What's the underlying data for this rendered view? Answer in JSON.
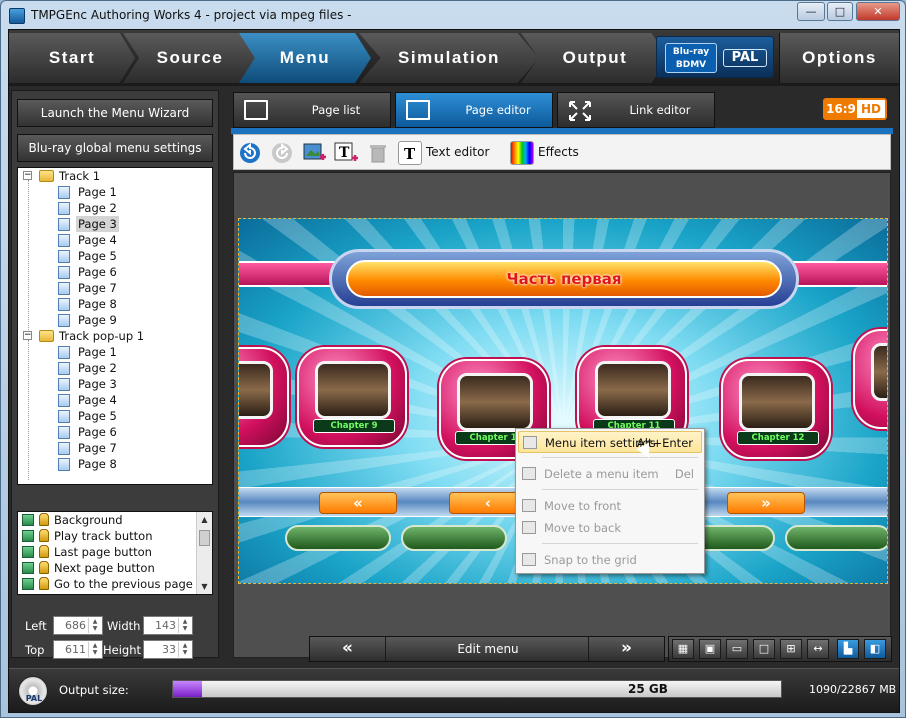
{
  "window": {
    "title": "TMPGEnc Authoring Works 4 - project via mpeg files -",
    "controls": {
      "minimize": "—",
      "maximize": "□",
      "close": "✕"
    }
  },
  "nav": {
    "items": [
      {
        "label": "Start",
        "active": false
      },
      {
        "label": "Source",
        "active": false
      },
      {
        "label": "Menu",
        "active": true
      },
      {
        "label": "Simulation",
        "active": false
      },
      {
        "label": "Output",
        "active": false
      }
    ],
    "format_logo_line1": "Blu-ray",
    "format_logo_line2": "BDMV",
    "format_standard": "PAL",
    "options": "Options"
  },
  "left": {
    "wizard_button": "Launch the Menu Wizard",
    "global_button": "Blu-ray global menu settings",
    "tree": [
      {
        "label": "Track 1",
        "type": "track",
        "expander": "−",
        "pages": [
          "Page 1",
          "Page 2",
          "Page 3",
          "Page 4",
          "Page 5",
          "Page 6",
          "Page 7",
          "Page 8",
          "Page 9"
        ],
        "selected": "Page 3"
      },
      {
        "label": "Track pop-up 1",
        "type": "track",
        "expander": "−",
        "pages": [
          "Page 1",
          "Page 2",
          "Page 3",
          "Page 4",
          "Page 5",
          "Page 6",
          "Page 7",
          "Page 8"
        ]
      }
    ],
    "layers": [
      "Background",
      "Play track button",
      "Last page button",
      "Next page button",
      "Go to the previous page button"
    ],
    "coords": {
      "left_label": "Left",
      "left_value": "686",
      "width_label": "Width",
      "width_value": "143",
      "top_label": "Top",
      "top_value": "611",
      "height_label": "Height",
      "height_value": "33"
    }
  },
  "tabs": [
    {
      "label": "Page list",
      "icon": "page-list-icon"
    },
    {
      "label": "Page editor",
      "icon": "page-editor-icon",
      "active": true
    },
    {
      "label": "Link editor",
      "icon": "link-editor-icon"
    }
  ],
  "aspect_badge": {
    "ratio": "16:9",
    "hd": "HD"
  },
  "toolbar": {
    "text_editor": "Text editor",
    "effects": "Effects"
  },
  "canvas": {
    "banner_title": "Часть первая",
    "chapters": [
      "Chapter 9",
      "Chapter 10",
      "Chapter 11",
      "Chapter 12"
    ],
    "nav_glyphs": [
      "«",
      "‹",
      "»"
    ]
  },
  "context_menu": [
    {
      "label": "Menu item settings",
      "shortcut": "Alt+Enter",
      "enabled": true,
      "highlighted": true
    },
    {
      "label": "Delete a menu item",
      "shortcut": "Del",
      "enabled": false
    },
    {
      "label": "Move to front",
      "shortcut": "",
      "enabled": false
    },
    {
      "label": "Move to back",
      "shortcut": "",
      "enabled": false
    },
    {
      "label": "Snap to the grid",
      "shortcut": "",
      "enabled": false
    }
  ],
  "bottom": {
    "prev": "«",
    "label": "Edit menu",
    "next": "»",
    "view_buttons": [
      "grid-icon",
      "safe-area-icon",
      "tv-icon",
      "frame-icon",
      "split-icon",
      "fit-width-icon",
      "align-icon",
      "layers-icon"
    ]
  },
  "status": {
    "disc_label": "PAL",
    "output_label": "Output size:",
    "capacity": "25 GB",
    "used_fraction": 0.048,
    "mb": "1090/22867  MB"
  }
}
